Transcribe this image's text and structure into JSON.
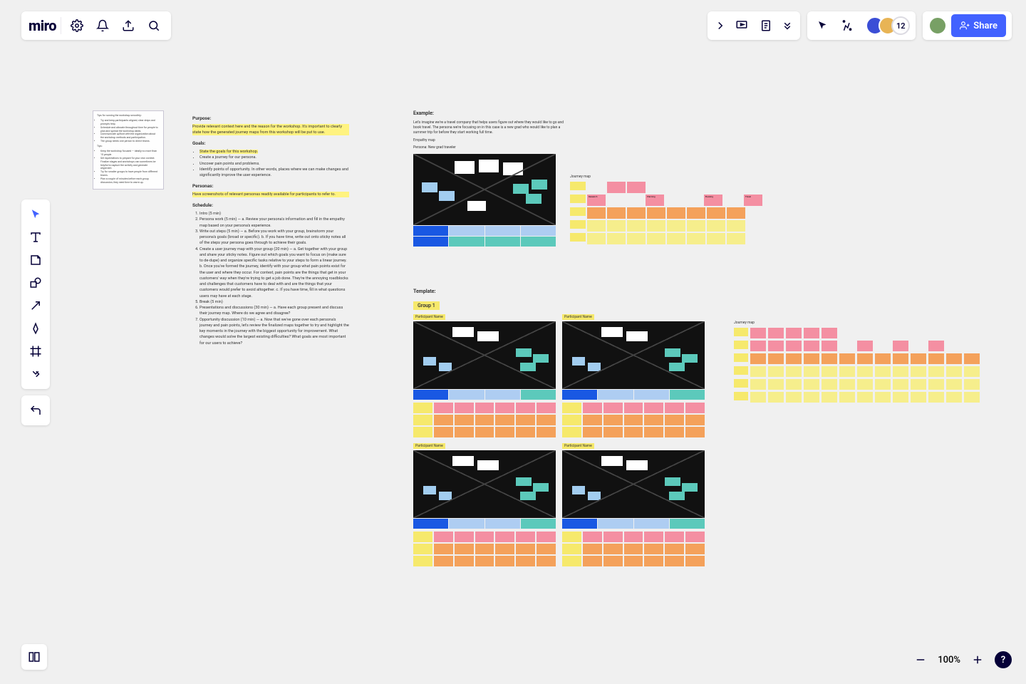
{
  "app": {
    "name": "miro"
  },
  "header": {
    "avatar_overflow": "12",
    "share_label": "Share"
  },
  "zoom": {
    "level": "100%"
  },
  "instructions": {
    "purpose_h": "Purpose:",
    "purpose_text": "Provide relevant context here and the reason for the workshop. It's important to clearly state how the generated journey maps from this workshop will be put to use.",
    "goals_h": "Goals:",
    "goals": [
      "State the goals for this workshop.",
      "Create a journey for our persona.",
      "Uncover pain points and problems.",
      "Identify points of opportunity. In other words, places where we can make changes and significantly improve the user experience."
    ],
    "personas_h": "Personas:",
    "personas_text": "Have screenshots of relevant personas readily available for participants to refer to.",
    "schedule_h": "Schedule:",
    "schedule": [
      "Intro (5 min)",
      "Persona work (5 min) — a. Review your persona's information and fill in the empathy map based on your persona's experience.",
      "Write out steps (5 min) — a. Before you work with your group, brainstorm your persona's goals (broad or specific). b. If you have time, write out onto sticky notes all of the steps your persona goes through to achieve their goals.",
      "Create a user journey map with your group (20 min) — a. Get together with your group and share your sticky notes. Figure out which goals you want to focus on (make sure to de-dupe) and organize specific tasks relative to your steps to form a linear journey. b. Once you've formed the journey, identify with your group what pain points exist for the user and where they occur. For context, pain points are the things that get in your customers' way when they're trying to get a job done. They're the annoying roadblocks and challenges that customers have to deal with and are the things that your customers would prefer to avoid altogether. c. If you have time, fill in what questions users may have at each stage.",
      "Break (5 min)",
      "Presentations and discussions (30 min) — a. Have each group present and discuss their journey map. Where do we agree and disagree?",
      "Opportunity discussion (10 min) — a. Now that we've gone over each persona's journey and pain points, let's review the finalized maps together to try and highlight the key moments in the journey with the biggest opportunity for improvement. What changes would solve the largest existing difficulties? What goals are most important for our users to achieve?"
    ]
  },
  "example": {
    "heading": "Example:",
    "intro": "Let's imagine we're a travel company that helps users figure out where they would like to go and book travel. The persona we're focusing on in this case is a new grad who would like to plan a summer trip for before they start working full time.",
    "empathy_label": "Empathy map",
    "persona_label": "Persona: New grad traveler",
    "journey_label": "Journey map",
    "phases": [
      "Research",
      "Planning",
      "Booking",
      "Travel"
    ]
  },
  "template": {
    "heading": "Template:",
    "group": "Group 1",
    "participant": "Participant Name",
    "journey_label": "Journey map"
  }
}
